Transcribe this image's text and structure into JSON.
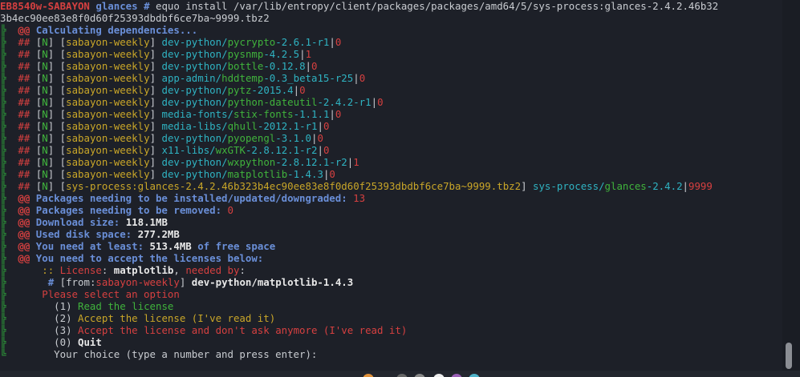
{
  "colors": {
    "background": "#1d2028",
    "red": "#d64040",
    "green": "#40b33c",
    "cyan": "#2fb3c2",
    "yellow": "#c9a628",
    "blue": "#6a8fd8"
  },
  "prompt": {
    "host": "EB8540w-SABAYON",
    "dir": "glances",
    "symbol": "#",
    "command": "equo install /var/lib/entropy/client/packages/packages/amd64/5/sys-process:glances-2.4.2.46b32",
    "command_cont": "3b4ec90ee83e8f0d60f25393dbdbf6ce7ba~9999.tbz2"
  },
  "calc_line": "Calculating dependencies...",
  "deps": [
    {
      "flag": "N",
      "repo": "sabayon-weekly",
      "cat": "dev-python/",
      "name": "pycrypto",
      "ver": "-2.6.1-r1",
      "slot": "0"
    },
    {
      "flag": "N",
      "repo": "sabayon-weekly",
      "cat": "dev-python/",
      "name": "pysnmp",
      "ver": "-4.2.5",
      "slot": "1"
    },
    {
      "flag": "N",
      "repo": "sabayon-weekly",
      "cat": "dev-python/",
      "name": "bottle",
      "ver": "-0.12.8",
      "slot": "0"
    },
    {
      "flag": "N",
      "repo": "sabayon-weekly",
      "cat": "app-admin/",
      "name": "hddtemp",
      "ver": "-0.3_beta15-r25",
      "slot": "0"
    },
    {
      "flag": "N",
      "repo": "sabayon-weekly",
      "cat": "dev-python/",
      "name": "pytz",
      "ver": "-2015.4",
      "slot": "0"
    },
    {
      "flag": "N",
      "repo": "sabayon-weekly",
      "cat": "dev-python/",
      "name": "python-dateutil",
      "ver": "-2.4.2-r1",
      "slot": "0"
    },
    {
      "flag": "N",
      "repo": "sabayon-weekly",
      "cat": "media-fonts/",
      "name": "stix-fonts",
      "ver": "-1.1.1",
      "slot": "0"
    },
    {
      "flag": "N",
      "repo": "sabayon-weekly",
      "cat": "media-libs/",
      "name": "qhull",
      "ver": "-2012.1-r1",
      "slot": "0"
    },
    {
      "flag": "N",
      "repo": "sabayon-weekly",
      "cat": "dev-python/",
      "name": "pyopengl",
      "ver": "-3.1.0",
      "slot": "0"
    },
    {
      "flag": "N",
      "repo": "sabayon-weekly",
      "cat": "x11-libs/",
      "name": "wxGTK",
      "ver": "-2.8.12.1-r2",
      "slot": "0"
    },
    {
      "flag": "N",
      "repo": "sabayon-weekly",
      "cat": "dev-python/",
      "name": "wxpython",
      "ver": "-2.8.12.1-r2",
      "slot": "1"
    },
    {
      "flag": "N",
      "repo": "sabayon-weekly",
      "cat": "dev-python/",
      "name": "matplotlib",
      "ver": "-1.4.3",
      "slot": "0"
    },
    {
      "flag": "N",
      "repo": "sys-process:glances-2.4.2.46b323b4ec90ee83e8f0d60f25393dbdbf6ce7ba~9999.tbz2",
      "cat": "sys-process/",
      "name": "glances",
      "ver": "-2.4.2",
      "slot": "9999"
    }
  ],
  "summary": {
    "needing_install_label": "Packages needing to be installed/updated/downgraded:",
    "needing_install_value": "13",
    "needing_remove_label": "Packages needing to be removed:",
    "needing_remove_value": "0",
    "download_label": "Download size:",
    "download_value": "118.1MB",
    "disk_label": "Used disk space:",
    "disk_value": "277.2MB",
    "need_label": "You need at least:",
    "need_value": "513.4MB",
    "need_suffix": "of free space",
    "accept_licenses": "You need to accept the licenses below:"
  },
  "license": {
    "prefix": "::",
    "label": "License",
    "name": "matplotlib",
    "needed_by": "needed by",
    "from_label": "from",
    "from_repo": "sabayon-weekly",
    "pkg": "dev-python/matplotlib-1.4.3"
  },
  "options": {
    "heading": "Please select an option",
    "items": [
      {
        "num": "(1)",
        "label": "Read the license"
      },
      {
        "num": "(2)",
        "label": "Accept the license (I've read it)"
      },
      {
        "num": "(3)",
        "label": "Accept the license and don't ask anymore (I've read it)"
      },
      {
        "num": "(0)",
        "label": "Quit"
      }
    ],
    "prompt": "Your choice (type a number and press enter):"
  },
  "markers": {
    "tree": "╠",
    "tree_end": "╚",
    "at": "@@",
    "hash": "##",
    "pipe": "|",
    "colon": ":",
    "comma": ",",
    "hashmark": "#"
  }
}
